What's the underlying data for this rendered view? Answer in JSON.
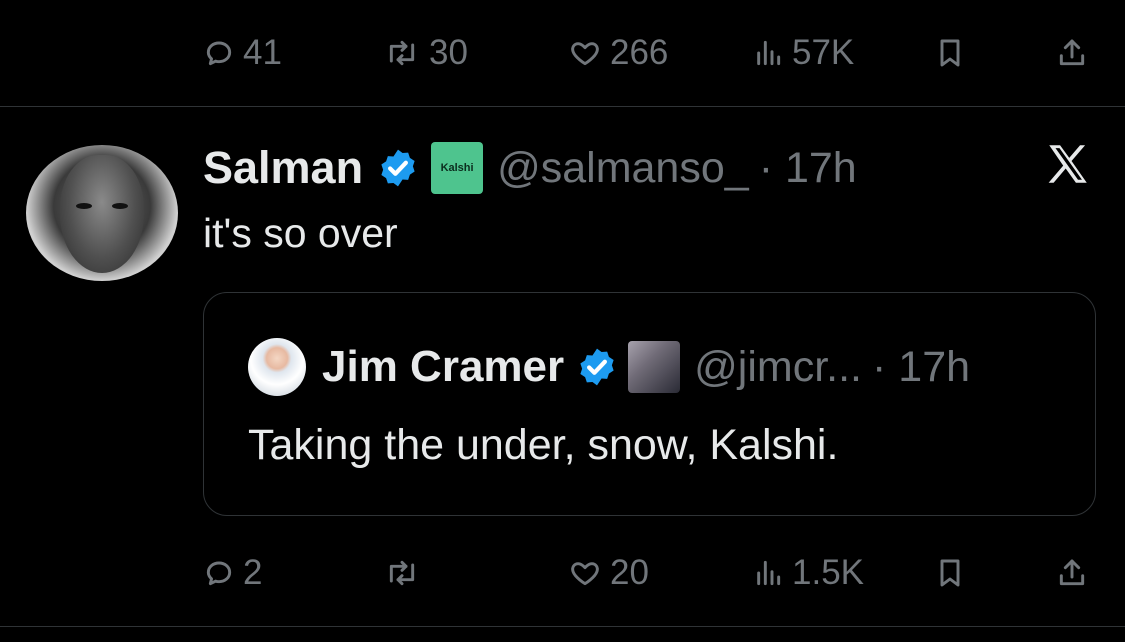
{
  "top_actions": {
    "replies": "41",
    "reposts": "30",
    "likes": "266",
    "views": "57K"
  },
  "tweet": {
    "display_name": "Salman",
    "affiliation_label": "Kalshi",
    "handle": "@salmanso_",
    "time": "· 17h",
    "text": "it's so over"
  },
  "quote": {
    "display_name": "Jim Cramer",
    "handle": "@jimcr...",
    "time": "· 17h",
    "text": "Taking the under, snow, Kalshi."
  },
  "bottom_actions": {
    "replies": "2",
    "reposts": "",
    "likes": "20",
    "views": "1.5K"
  },
  "colors": {
    "background": "#000000",
    "text": "#e7e9ea",
    "muted": "#71767b",
    "divider": "#2f3336",
    "verified": "#1d9bf0",
    "kalshi_green": "#4ec48e"
  }
}
